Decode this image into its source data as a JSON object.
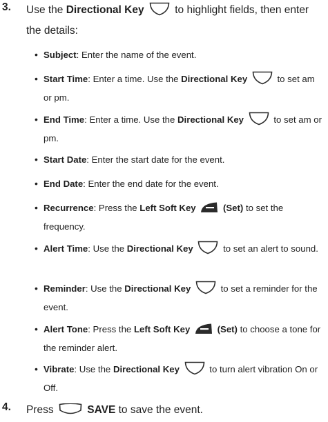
{
  "step3": {
    "number": "3.",
    "intro_a": "Use the",
    "intro_key": "Directional Key",
    "intro_b": "to highlight fields, then enter the details:"
  },
  "bullets": [
    {
      "label": "Subject",
      "parts": [
        ": Enter the name of the event."
      ]
    },
    {
      "label": "Start Time",
      "parts": [
        ": Enter a time. Use the",
        "Directional Key",
        "to set am or pm."
      ]
    },
    {
      "label": "End Time",
      "parts": [
        ": Enter a time. Use the",
        "Directional Key",
        "to set am or pm."
      ]
    },
    {
      "label": "Start Date",
      "parts": [
        ": Enter the start date for the event."
      ]
    },
    {
      "label": "End Date",
      "parts": [
        ": Enter the end date for the event."
      ]
    },
    {
      "label": "Recurrence",
      "parts": [
        ": Press the",
        "Left Soft Key",
        "(Set)",
        "to set the frequency."
      ]
    },
    {
      "label": "Alert Time",
      "parts": [
        ": Use the",
        "Directional Key",
        "to set an alert to sound."
      ]
    },
    {
      "label": "Reminder",
      "parts": [
        ": Use the",
        "Directional Key",
        "to set a reminder for the event."
      ]
    },
    {
      "label": "Alert Tone",
      "parts": [
        ": Press the",
        "Left Soft Key",
        "(Set)",
        "to choose a tone for the reminder alert."
      ]
    },
    {
      "label": "Vibrate",
      "parts": [
        ": Use the",
        "Directional Key",
        "to turn alert vibration On or Off."
      ]
    }
  ],
  "step4": {
    "number": "4.",
    "press": "Press",
    "save": "SAVE",
    "rest": "to save the event."
  },
  "icons": {
    "directional_key": "directional-key-icon",
    "left_soft_key": "left-soft-key-icon",
    "right_soft_key": "soft-key-icon",
    "icon_color": "#2b2b2b"
  }
}
